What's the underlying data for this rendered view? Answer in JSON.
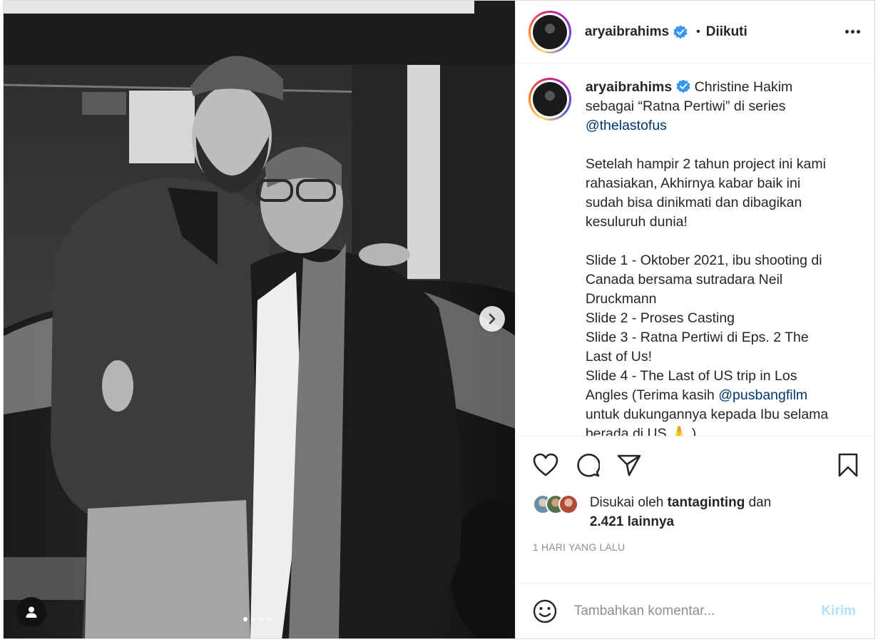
{
  "post": {
    "username": "aryaibrahims",
    "separator": "•",
    "follow_status": "Diikuti"
  },
  "caption": {
    "username": "aryaibrahims",
    "line1_text": " Christine Hakim sebagai “Ratna Pertiwi” di series ",
    "mention1": "@thelastofus",
    "paragraph2": "Setelah hampir 2 tahun project ini kami rahasiakan, Akhirnya kabar baik ini sudah bisa dinikmati dan dibagikan kesuluruh dunia!",
    "slide1": "Slide 1 - Oktober 2021, ibu shooting di Canada bersama sutradara Neil Druckmann",
    "slide2": "Slide 2 - Proses Casting",
    "slide3": "Slide 3 - Ratna Pertiwi di Eps. 2 The Last of Us!",
    "slide4_start": "Slide 4 - The Last of US trip in Los Angles (Terima kasih ",
    "mention2": "@pusbangfilm",
    "slide4_end": " untuk dukungannya kepada Ibu selama berada di US 🙏 )"
  },
  "likes": {
    "prefix": "Disukai oleh",
    "liker": "tantaginting",
    "connector": "dan",
    "others": "2.421 lainnya"
  },
  "timestamp": "1 HARI YANG LALU",
  "comment": {
    "placeholder": "Tambahkan komentar...",
    "post_label": "Kirim"
  },
  "carousel": {
    "total_slides": 4,
    "current_slide": 1
  },
  "colors": {
    "verified": "#3897f0",
    "mention": "#00376b",
    "post_button_disabled": "#b2dffc",
    "muted": "#8e8e8e"
  },
  "icons": [
    "more-options-icon",
    "verified-badge-icon",
    "heart-icon",
    "comment-icon",
    "share-icon",
    "bookmark-icon",
    "emoji-icon",
    "next-arrow-icon",
    "user-tag-icon"
  ]
}
